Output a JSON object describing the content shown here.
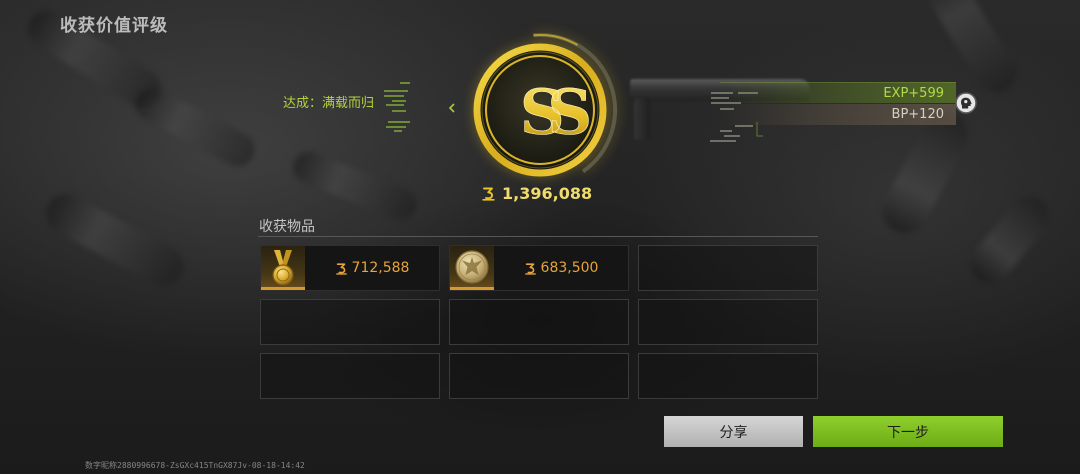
{
  "header": {
    "title": "收获价值评级"
  },
  "achievement": {
    "text": "达成：满载而归",
    "chevron_icon": "chevron-left-icon"
  },
  "rating": {
    "grade": "SS",
    "emblem_icon": "ss-grade-emblem",
    "currency_icon": "koen-coin-icon",
    "total_value": "1,396,088"
  },
  "rewards": {
    "exp": "EXP+599",
    "bp": "BP+120",
    "profile_icon": "profile-head-icon"
  },
  "loot": {
    "title": "收获物品",
    "currency_icon": "koen-coin-icon",
    "slots": [
      {
        "icon": "gold-medal-icon",
        "value": "712,588"
      },
      {
        "icon": "eagle-gold-coin-icon",
        "value": "683,500"
      },
      {},
      {},
      {},
      {},
      {},
      {},
      {}
    ]
  },
  "actions": {
    "share": "分享",
    "next": "下一步"
  },
  "footer": {
    "watermark": "数字昵称2880996678-ZsGXc415TnGX87Jv-08-18-14:42"
  },
  "colors": {
    "background": "#242424",
    "gold": "#e8c328",
    "total_text": "#f1dc6b",
    "achievement_green": "#b4d33c",
    "exp_green": "#b2dc45",
    "bp_text": "#d6cfc2",
    "loot_value": "#e6a43a",
    "share_button": "#c4c4c4",
    "next_button": "#7dbe1f"
  }
}
